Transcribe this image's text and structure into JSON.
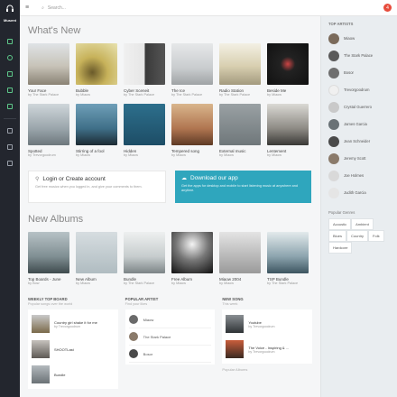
{
  "rail": {
    "brand": "Musent"
  },
  "topbar": {
    "search_placeholder": "Search...",
    "notif_count": "4"
  },
  "whats_new": {
    "title": "What's New",
    "row1": [
      {
        "title": "Your Face",
        "artist": "by The Stark Palace"
      },
      {
        "title": "Bubble",
        "artist": "by Miaow"
      },
      {
        "title": "Cyber Sceneit",
        "artist": "by The Stark Palace"
      },
      {
        "title": "The Ice",
        "artist": "by The Stark Palace"
      },
      {
        "title": "Radio Station",
        "artist": "by The Stark Palace"
      },
      {
        "title": "Beside Me",
        "artist": "by Miaow"
      }
    ],
    "row2": [
      {
        "title": "Spotted",
        "artist": "by Trevorgoodrum"
      },
      {
        "title": "Stirring of a fool",
        "artist": "by Miaow"
      },
      {
        "title": "Hidden",
        "artist": "by Miaow"
      },
      {
        "title": "Tempered song",
        "artist": "by Miaow"
      },
      {
        "title": "External music",
        "artist": "by Miaow"
      },
      {
        "title": "Lentement",
        "artist": "by Miaow"
      }
    ]
  },
  "promo": {
    "login_title": "Login or Create account",
    "login_text": "Get free musics when you logged in, and give your comments to them.",
    "download_title": "Download our app",
    "download_text": "Get the apps for desktop and mobile to start listening music at anywhere and anytime."
  },
  "new_albums": {
    "title": "New Albums",
    "items": [
      {
        "title": "Top Boards - June",
        "artist": "by Bow"
      },
      {
        "title": "New Album",
        "artist": "by Miaow"
      },
      {
        "title": "Bundle",
        "artist": "by The Stark Palace"
      },
      {
        "title": "Free Album",
        "artist": "by Miaow"
      },
      {
        "title": "Miaow 2004",
        "artist": "by Miaow"
      },
      {
        "title": "TSP Bundle",
        "artist": "by The Stark Palace"
      }
    ]
  },
  "weekly": {
    "title": "WEEKLY TOP BOARD",
    "sub": "Popular songs over the world",
    "items": [
      {
        "title": "Country girl shake it for me",
        "artist": "by Trevorgoodrum"
      },
      {
        "title": "SHOOTLast",
        "artist": ""
      },
      {
        "title": "Bundle",
        "artist": ""
      }
    ]
  },
  "popular": {
    "title": "POPULAR ARTIST",
    "sub": "Find your likes",
    "items": [
      "Miaow",
      "The Stark Palace",
      "Bosor"
    ]
  },
  "new_song": {
    "title": "NEW SONG",
    "sub": "This week",
    "items": [
      {
        "title": "Youtube",
        "artist": "by Trevorgoodrum"
      },
      {
        "title": "The Voice - Inspiring & ...",
        "artist": "by Trevorgoodrum"
      }
    ],
    "footer": "Popular Albums"
  },
  "right": {
    "top_artists_title": "TOP ARTISTS",
    "artists": [
      "Miaow",
      "The Stark Palace",
      "Bosor",
      "Trevorgoodrum",
      "Crystal Guerrero",
      "James Garcia",
      "Jean Schneider",
      "Jeremy Scott",
      "Joe Holmes",
      "Judith Garcia"
    ],
    "genres_title": "Popular Genres",
    "genres": [
      "Acoustic",
      "Ambient",
      "Blues",
      "Country",
      "Folk",
      "Hardcore"
    ]
  }
}
